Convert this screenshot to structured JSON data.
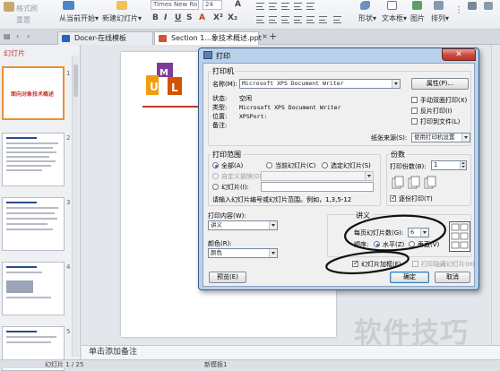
{
  "ribbon": {
    "format_painter": "格式刷",
    "reset": "重置",
    "from_current": "从当前开始",
    "new_slide": "新建幻灯片",
    "font_name": "Times New Ro",
    "font_size": "24",
    "shape": "形状",
    "textbox": "文本框",
    "picture": "图片",
    "arrange": "排列"
  },
  "tabs": [
    {
      "label": "Docer-在线模板"
    },
    {
      "label": "Section 1...象技术概述.ppt"
    }
  ],
  "left_panel": {
    "header": "幻灯片",
    "slide1_title": "面向对象技术概述",
    "slide_numbers": [
      "1",
      "2",
      "3",
      "4",
      "5"
    ]
  },
  "notes_placeholder": "单击添加备注",
  "status": {
    "slide_count": "幻灯片 1 / 25",
    "template": "新模板1"
  },
  "dialog": {
    "title": "打印",
    "printer": {
      "group": "打印机",
      "name_label": "名称(M):",
      "name_value": "Microsoft XPS Document Writer",
      "properties_btn": "属性(P)...",
      "status_label": "状态:",
      "status_value": "空闲",
      "type_label": "类型:",
      "type_value": "Microsoft XPS Document Writer",
      "location_label": "位置:",
      "location_value": "XPSPort:",
      "comment_label": "备注:",
      "manual_duplex": "手动双面打印(X)",
      "reverse_print": "反片打印(I)",
      "print_to_file": "打印到文件(L)",
      "paper_source_label": "纸张来源(S):",
      "paper_source_value": "使用打印机设置"
    },
    "range": {
      "group": "打印范围",
      "all": "全部(A)",
      "current": "当前幻灯片(C)",
      "selection": "选定幻灯片(S)",
      "custom_show": "自定义放映(0):",
      "slides": "幻灯片(I):",
      "hint": "请输入幻灯片编号或幻灯片范围。例如，1,3,5-12"
    },
    "copies": {
      "group": "份数",
      "label": "打印份数(B):",
      "value": "1",
      "collate": "逐份打印(T)"
    },
    "content": {
      "label": "打印内容(W):",
      "value": "讲义"
    },
    "color": {
      "label": "颜色(R):",
      "value": "颜色"
    },
    "handouts": {
      "group": "讲义",
      "per_page_label": "每页幻灯片数(G):",
      "per_page_value": "6",
      "order_label": "顺序:",
      "horizontal": "水平(Z)",
      "vertical": "垂直(V)"
    },
    "frame_slides": "幻灯片加框(F)",
    "print_hidden": "打印隐藏幻灯片(H)",
    "preview_btn": "预览(E)",
    "ok_btn": "确定",
    "cancel_btn": "取消"
  },
  "watermark": "软件技巧"
}
